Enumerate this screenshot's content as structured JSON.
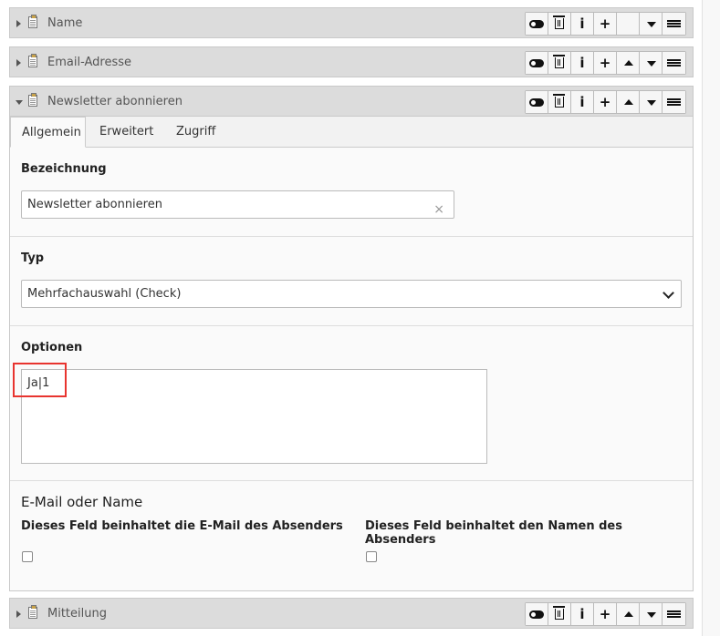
{
  "panels": [
    {
      "title": "Name"
    },
    {
      "title": "Email-Adresse"
    },
    {
      "title": "Newsletter abonnieren"
    },
    {
      "title": "Mitteilung"
    }
  ],
  "buttons": {
    "info": "i",
    "add": "+"
  },
  "icons": {
    "toggle": "toggle-icon",
    "delete": "trash-icon",
    "info": "info-icon",
    "add": "plus-icon",
    "up": "arrow-up-icon",
    "down": "arrow-down-icon",
    "menu": "hamburger-icon",
    "clear": "×"
  },
  "tabs": [
    "Allgemein",
    "Erweitert",
    "Zugriff"
  ],
  "form": {
    "bezeichnung_label": "Bezeichnung",
    "bezeichnung_value": "Newsletter abonnieren",
    "typ_label": "Typ",
    "typ_value": "Mehrfachauswahl (Check)",
    "optionen_label": "Optionen",
    "optionen_value": "Ja|1",
    "section_heading": "E-Mail oder Name",
    "email_label": "Dieses Feld beinhaltet die E-Mail des Absenders",
    "name_label": "Dieses Feld beinhaltet den Namen des Absenders"
  },
  "colors": {
    "highlight": "#e8342f",
    "header_bg": "#dcdcdc"
  }
}
